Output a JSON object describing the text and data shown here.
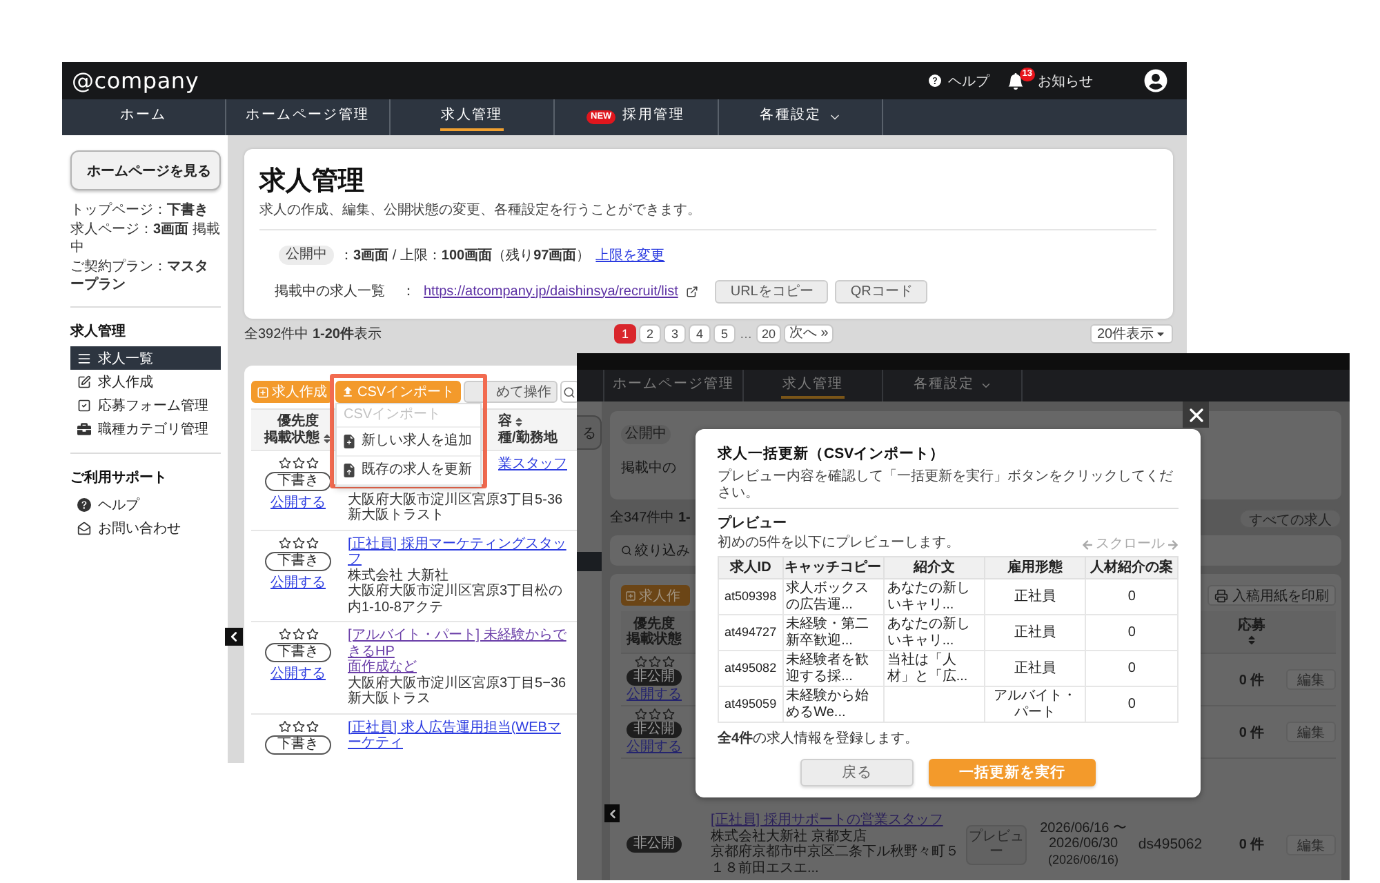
{
  "app": {
    "logo": "@company",
    "help": "ヘルプ",
    "notifications": {
      "label": "お知らせ",
      "count": "13"
    },
    "nav": [
      {
        "label": "ホーム",
        "selected": false,
        "menu": false
      },
      {
        "label": "ホームページ管理",
        "selected": false,
        "menu": false
      },
      {
        "label": "求人管理",
        "selected": true,
        "menu": false
      },
      {
        "label": "採用管理",
        "selected": false,
        "menu": false,
        "badge": "NEW"
      },
      {
        "label": "各種設定",
        "selected": false,
        "menu": true
      }
    ],
    "sidebar": {
      "view_site": "ホームページを見る",
      "info": [
        "トップページ：**下書き**",
        "求人ページ：**3画面** 掲載中",
        "ご契約プラン：**マスタープラン**"
      ],
      "sections": [
        {
          "title": "求人管理",
          "items": [
            {
              "label": "求人一覧",
              "selected": true
            },
            {
              "label": "求人作成",
              "selected": false
            },
            {
              "label": "応募フォーム管理",
              "selected": false
            },
            {
              "label": "職種カテゴリ管理",
              "selected": false
            }
          ]
        },
        {
          "title": "ご利用サポート",
          "items": [
            {
              "label": "ヘルプ",
              "selected": false
            },
            {
              "label": "お問い合わせ",
              "selected": false
            }
          ]
        }
      ]
    },
    "page_header": {
      "title": "求人管理",
      "description": "求人の作成、編集、公開状態の変更、各種設定を行うことができます。",
      "status": {
        "badge": "公開中",
        "text": "：**3画面** / 上限：**100画面**（残り**97画面**）",
        "link": "上限を変更"
      },
      "listing": {
        "label": "掲載中の求人一覧",
        "separator": "：",
        "url": "https://atcompany.jp/daishinsya/recruit/list",
        "visited": true,
        "buttons": [
          "URLをコピー",
          "QRコード"
        ]
      }
    },
    "results": {
      "summary": "全392件中 **1-20件**表示",
      "pages": [
        {
          "kind": "page",
          "label": "1",
          "selected": true
        },
        {
          "kind": "page",
          "label": "2",
          "selected": false
        },
        {
          "kind": "page",
          "label": "3",
          "selected": false
        },
        {
          "kind": "page",
          "label": "4",
          "selected": false
        },
        {
          "kind": "page",
          "label": "5",
          "selected": false
        },
        {
          "kind": "gap",
          "label": "…"
        },
        {
          "kind": "page",
          "label": "20",
          "selected": false
        },
        {
          "kind": "next",
          "label": "次へ »",
          "selected": false
        }
      ],
      "per_page": "20件表示"
    },
    "jobs_table": {
      "toolbar": [
        {
          "kind": "primary",
          "label": "求人作成"
        },
        {
          "kind": "import",
          "label": "CSVインポート"
        },
        {
          "kind": "secondary",
          "label": "めて操作"
        },
        {
          "kind": "search"
        }
      ],
      "import_menu": {
        "open": true,
        "highlighted": true,
        "heading": "CSVインポート",
        "items": [
          "新しい求人を追加",
          "既存の求人を更新"
        ]
      },
      "columns": [
        [
          "優先度",
          "掲載状態"
        ],
        [
          "容",
          "種/勤務地"
        ]
      ],
      "rows": [
        {
          "stars": 0,
          "status": "下書き",
          "publish_link": "公開する",
          "title": "業スタッフ",
          "visited": false,
          "address": "大阪府大阪市淀川区宮原3丁目5-36新大阪トラスト"
        },
        {
          "stars": 0,
          "status": "下書き",
          "publish_link": "公開する",
          "title": "[正社員] 採用マーケティングスタッフ",
          "visited": false,
          "company": "株式会社 大新社",
          "address": "大阪府大阪市淀川区宮原3丁目松の内1-10-8アクテ"
        },
        {
          "stars": 0,
          "status": "下書き",
          "publish_link": "公開する",
          "title": "[アルバイト・パート] 未経験からできるHP",
          "title_continued": "面作成など",
          "visited": true,
          "address": "大阪府大阪市淀川区宮原3丁目5−36新大阪トラス"
        },
        {
          "stars": 0,
          "status": "下書き",
          "title": "[正社員] 求人広告運用担当(WEBマーケティ",
          "visited": false
        }
      ]
    }
  },
  "preview_app": {
    "nav": [
      {
        "label": "ホームページ管理",
        "selected": false,
        "menu": false
      },
      {
        "label": "求人管理",
        "selected": true,
        "menu": false
      },
      {
        "label": "各種設定",
        "selected": false,
        "menu": true
      }
    ],
    "sidebar_button": "る",
    "status_badge": "公開中",
    "listing_label": "掲載中の",
    "count": "全347件中 **1-**",
    "filter": "すべての求人",
    "search": "絞り込み",
    "create": "求人作",
    "print": "入稿用紙を印刷",
    "columns": {
      "status": [
        "優先度",
        "掲載状態"
      ],
      "applications": "応募"
    },
    "rows": [
      {
        "stars": 0,
        "status": "非公開",
        "publish_link": "公開する",
        "applications": "0 件",
        "edit": "編集"
      },
      {
        "stars": 0,
        "status": "非公開",
        "publish_link": "公開する",
        "applications": "0 件",
        "edit": "編集"
      },
      {
        "status": "非公開",
        "title": "[正社員] 採用サポートの営業スタッフ",
        "company": "株式会社大新社 京都支店",
        "address": "京都府京都市中京区二条下ル秋野々町５１８前田エスエ...",
        "preview": "プレビュー",
        "period": [
          "2026/06/16 〜",
          "2026/06/30",
          "(2026/06/16)"
        ],
        "job_id": "ds495062",
        "applications": "0 件",
        "edit": "編集"
      }
    ]
  },
  "modal": {
    "title": "求人一括更新（CSVインポート）",
    "description": "プレビュー内容を確認して「一括更新を実行」ボタンをクリックしてください。",
    "preview_heading": "プレビュー",
    "preview_note": "初めの5件を以下にプレビューします。",
    "scroll_hint": "スクロール",
    "columns": [
      "求人ID",
      "キャッチコピー",
      "紹介文",
      "雇用形態",
      "人材紹介の案"
    ],
    "rows": [
      {
        "id": "at509398",
        "catch_copy": "求人ボックスの広告運...",
        "intro": "あなたの新しいキャリ...",
        "employment": "正社員",
        "referral": "0"
      },
      {
        "id": "at494727",
        "catch_copy": "未経験・第二新卒歓迎...",
        "intro": "あなたの新しいキャリ...",
        "employment": "正社員",
        "referral": "0"
      },
      {
        "id": "at495082",
        "catch_copy": "未経験者を歓迎する採...",
        "intro": "当社は「人材」と「広...",
        "employment": "正社員",
        "referral": "0"
      },
      {
        "id": "at495059",
        "catch_copy": "未経験から始めるWe...",
        "employment": "アルバイト・パート",
        "referral": "0"
      }
    ],
    "summary": "**全4件**の求人情報を登録します。",
    "buttons": [
      {
        "kind": "secondary",
        "label": "戻る"
      },
      {
        "kind": "primary",
        "label": "一括更新を実行"
      }
    ]
  }
}
